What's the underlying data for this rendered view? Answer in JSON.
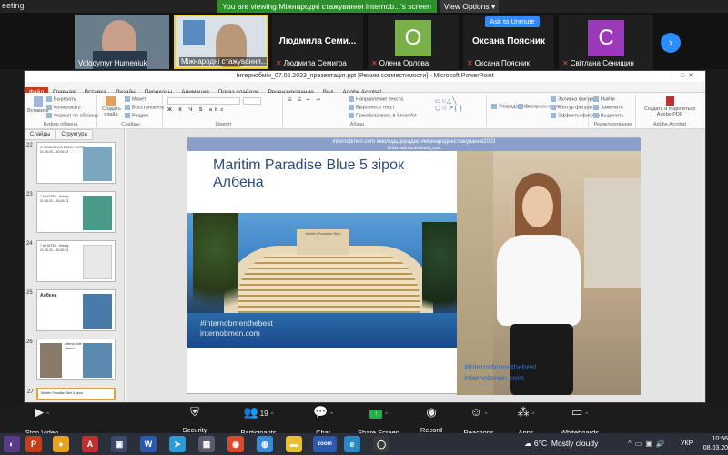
{
  "zoom": {
    "window_title": "eeting",
    "banner": "You are viewing Міжнародні стажування Internob...'s screen",
    "view_options": "View Options",
    "ask_to_unmute": "Ask to Unmute",
    "participants": [
      {
        "name": "Volodymyr Humeniuk",
        "muted": false
      },
      {
        "name": "Міжнародні стажування...",
        "muted": false
      },
      {
        "name": "Людмила Семигра",
        "muted": true,
        "display": "Людмила Семи..."
      },
      {
        "name": "Олена Орлова",
        "muted": true,
        "initial": "О"
      },
      {
        "name": "Оксана Поясник",
        "muted": true,
        "display": "Оксана Поясник"
      },
      {
        "name": "Світлана Сенищин",
        "muted": true,
        "initial": "С"
      }
    ],
    "toolbar": {
      "stop_video": "Stop Video",
      "security": "Security",
      "participants": "Participants",
      "participants_count": "19",
      "chat": "Chat",
      "share_screen": "Share Screen",
      "record": "Record",
      "reactions": "Reactions",
      "apps": "Apps",
      "whiteboards": "Whiteboards"
    }
  },
  "ppt": {
    "title": "Інтернобмін_07.02.2023_презентація.ppt [Режим совместимости] - Microsoft PowerPoint",
    "tabs": [
      "Файл",
      "Главная",
      "Вставка",
      "Дизайн",
      "Переходы",
      "Анимация",
      "Показ слайдов",
      "Рецензирование",
      "Вид",
      "Adobe Acrobat"
    ],
    "ribbon": {
      "paste": "Вставить",
      "cut": "Вырезать",
      "copy": "Копировать",
      "format_painter": "Формат по образцу",
      "clipboard": "Буфер обмена",
      "create_slide": "Создать слайд",
      "layout": "Макет",
      "restore": "Восстановить",
      "section": "Раздел",
      "slides": "Слайды",
      "font": "Шрифт",
      "text_direction": "Направление текста",
      "align_text": "Выровнять текст",
      "convert_smartart": "Преобразовать в SmartArt",
      "paragraph": "Абзац",
      "arrange": "Упорядочить",
      "quick_styles": "Экспресс-стили",
      "shape_fill": "Заливка фигуры",
      "shape_outline": "Контур фигуры",
      "shape_effects": "Эффекты фигуры",
      "find": "Найти",
      "replace": "Заменить",
      "select": "Выделить",
      "editing": "Редактирование",
      "create_pdf": "Создать и поделиться Adobe PDF",
      "adobe_acrobat": "Adobe Acrobat"
    },
    "left_tabs": [
      "Слайды",
      "Структура"
    ],
    "thumbnails": [
      {
        "num": "22",
        "lines": [
          "4* MAGNOLIYA  BEACH HOTEL",
          "01.05.23 – 30.09.23"
        ]
      },
      {
        "num": "23",
        "lines": [
          "7 & HOTEL - Hotelly",
          "01.05.23 – 30.09.23"
        ]
      },
      {
        "num": "24",
        "lines": [
          "7 & HOTEL - Hotelly",
          "01.05.23 – 30.09.23"
        ]
      },
      {
        "num": "25",
        "lines": [
          "Албена"
        ]
      },
      {
        "num": "26",
        "lines": [
          "albena  slide",
          "albena"
        ]
      },
      {
        "num": "27",
        "lines": [
          "Maritim Paradise Blue 5 зірок"
        ]
      }
    ],
    "slide": {
      "header_line1": "internobmen.com     #молодьдорадас     #міжнароднестажування2023",
      "header_line2": "#internobmenthebest_com",
      "title": "Maritim Paradise Blue 5 зірок Албена",
      "hotel_sign": "Maritim Paradise Blue",
      "watermark_hashtag": "#internobmenthebest",
      "watermark_url": "internobmen.com"
    }
  },
  "taskbar": {
    "weather_temp": "6°C",
    "weather_desc": "Mostly cloudy",
    "lang": "УКР",
    "time": "10:56",
    "date": "08.03.20"
  }
}
